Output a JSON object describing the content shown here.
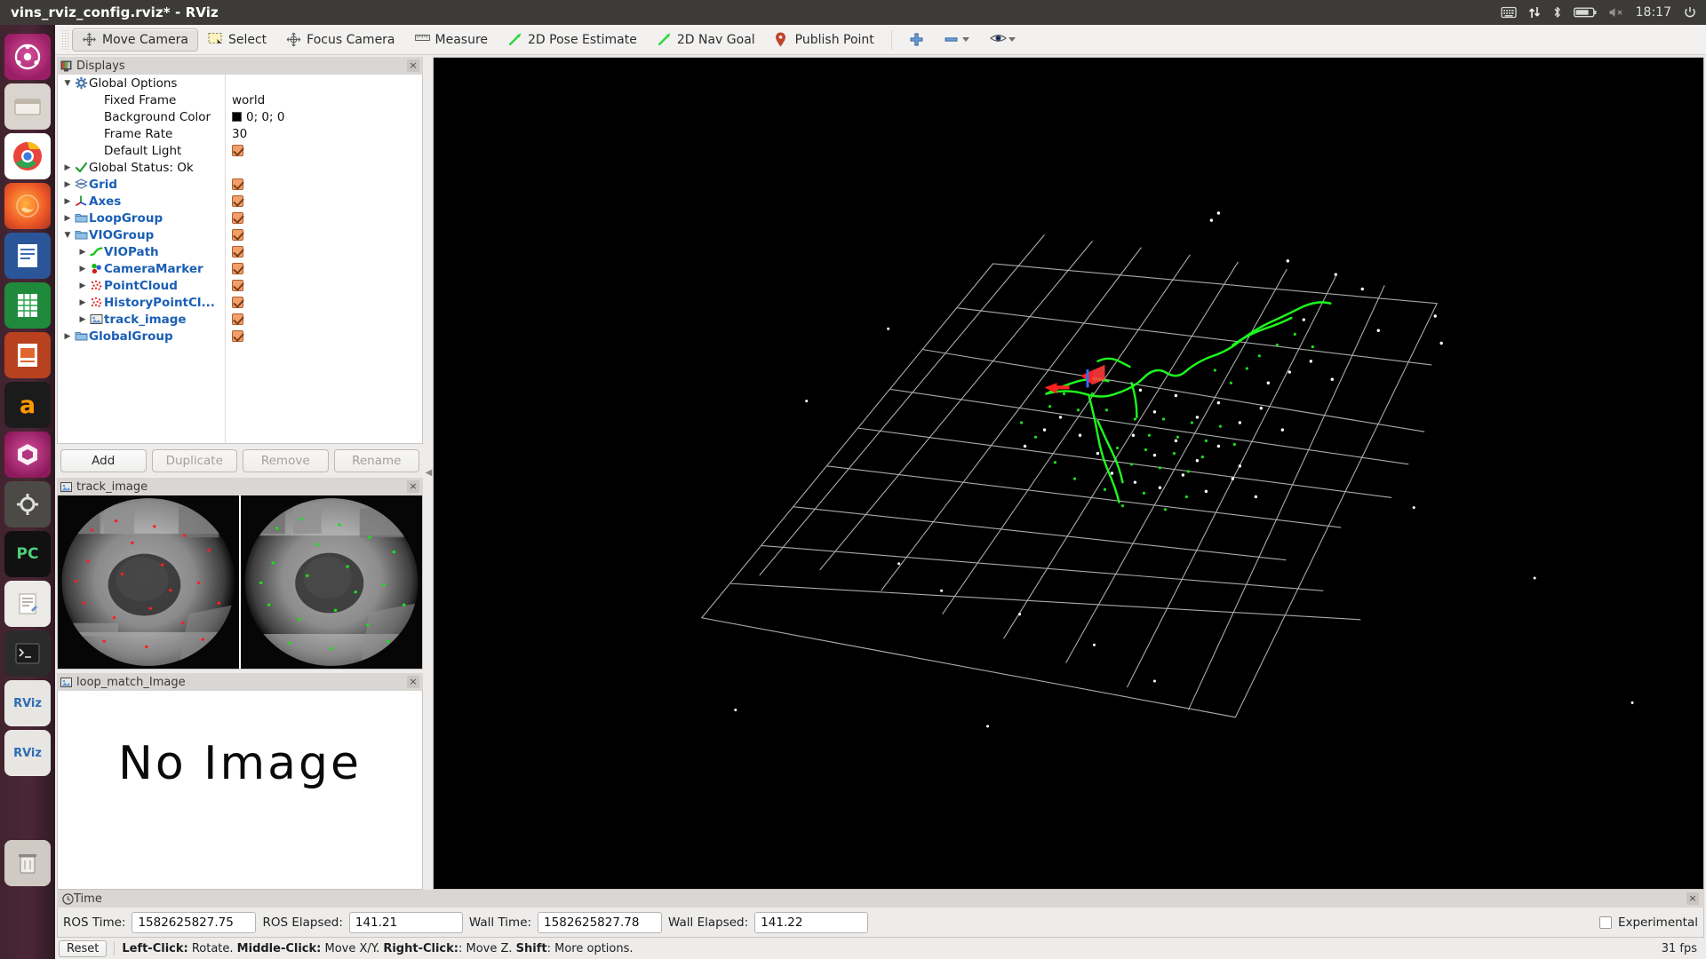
{
  "window": {
    "title": "vins_rviz_config.rviz* - RViz"
  },
  "tray": {
    "icons": [
      "keyboard-icon",
      "network-icon",
      "bluetooth-icon",
      "battery-icon",
      "volume-muted-icon"
    ],
    "clock": "18:17",
    "power_icon": "power-icon"
  },
  "launcher": {
    "items": [
      {
        "name": "ubuntu-dash",
        "glyph": "●"
      },
      {
        "name": "files",
        "glyph": "▤"
      },
      {
        "name": "chrome",
        "glyph": "●"
      },
      {
        "name": "firefox",
        "glyph": "●"
      },
      {
        "name": "libreoffice-writer",
        "glyph": "▤"
      },
      {
        "name": "libreoffice-calc",
        "glyph": "▤"
      },
      {
        "name": "libreoffice-impress",
        "glyph": "▤"
      },
      {
        "name": "amazon",
        "glyph": "a"
      },
      {
        "name": "ubuntu-software",
        "glyph": "●"
      },
      {
        "name": "pycharm",
        "glyph": "PC"
      },
      {
        "name": "system-settings",
        "glyph": "●"
      },
      {
        "name": "text-editor",
        "glyph": "✎"
      },
      {
        "name": "terminal",
        "glyph": "▣"
      },
      {
        "name": "rviz-1",
        "glyph": "RViz"
      },
      {
        "name": "rviz-2",
        "glyph": "RViz"
      },
      {
        "name": "trash",
        "glyph": "▤"
      }
    ]
  },
  "toolbar": {
    "buttons": [
      {
        "label": "Move Camera",
        "icon": "move-camera-icon",
        "active": true
      },
      {
        "label": "Select",
        "icon": "select-icon",
        "active": false
      },
      {
        "label": "Focus Camera",
        "icon": "focus-camera-icon",
        "active": false
      },
      {
        "label": "Measure",
        "icon": "measure-icon",
        "active": false
      },
      {
        "label": "2D Pose Estimate",
        "icon": "pose-arrow-icon",
        "active": false
      },
      {
        "label": "2D Nav Goal",
        "icon": "nav-arrow-icon",
        "active": false
      },
      {
        "label": "Publish Point",
        "icon": "map-pin-icon",
        "active": false
      }
    ],
    "add_tool_icon": "plus-icon",
    "remove_tool_icon": "minus-icon",
    "visibility_icon": "eye-icon",
    "dropdown_icon": "chevron-down-icon"
  },
  "displays_panel": {
    "title": "Displays",
    "icon": "displays-icon",
    "close_icon": "close-icon",
    "tree": [
      {
        "indent": 0,
        "arrow": "down",
        "icon": "gear-icon",
        "label": "Global Options",
        "blue": false,
        "value": "",
        "checkbox": false
      },
      {
        "indent": 1,
        "arrow": "none",
        "icon": "none",
        "label": "Fixed Frame",
        "blue": false,
        "value": "world",
        "checkbox": false
      },
      {
        "indent": 1,
        "arrow": "none",
        "icon": "none",
        "label": "Background Color",
        "blue": false,
        "value": "0; 0; 0",
        "swatch": "#000000",
        "checkbox": false
      },
      {
        "indent": 1,
        "arrow": "none",
        "icon": "none",
        "label": "Frame Rate",
        "blue": false,
        "value": "30",
        "checkbox": false
      },
      {
        "indent": 1,
        "arrow": "none",
        "icon": "none",
        "label": "Default Light",
        "blue": false,
        "value": "",
        "checkbox": true
      },
      {
        "indent": 0,
        "arrow": "right",
        "icon": "check-icon",
        "label": "Global Status: Ok",
        "blue": false,
        "value": "",
        "checkbox": false
      },
      {
        "indent": 0,
        "arrow": "right",
        "icon": "grid-icon",
        "label": "Grid",
        "blue": true,
        "value": "",
        "checkbox": true
      },
      {
        "indent": 0,
        "arrow": "right",
        "icon": "axes-icon",
        "label": "Axes",
        "blue": true,
        "value": "",
        "checkbox": true
      },
      {
        "indent": 0,
        "arrow": "right",
        "icon": "folder-icon",
        "label": "LoopGroup",
        "blue": true,
        "value": "",
        "checkbox": true
      },
      {
        "indent": 0,
        "arrow": "down",
        "icon": "folder-icon",
        "label": "VIOGroup",
        "blue": true,
        "value": "",
        "checkbox": true
      },
      {
        "indent": 1,
        "arrow": "right",
        "icon": "path-icon",
        "label": "VIOPath",
        "blue": true,
        "value": "",
        "checkbox": true
      },
      {
        "indent": 1,
        "arrow": "right",
        "icon": "marker-icon",
        "label": "CameraMarker",
        "blue": true,
        "value": "",
        "checkbox": true
      },
      {
        "indent": 1,
        "arrow": "right",
        "icon": "pointcloud-icon",
        "label": "PointCloud",
        "blue": true,
        "value": "",
        "checkbox": true
      },
      {
        "indent": 1,
        "arrow": "right",
        "icon": "pointcloud-icon",
        "label": "HistoryPointCl...",
        "blue": true,
        "value": "",
        "checkbox": true
      },
      {
        "indent": 1,
        "arrow": "right",
        "icon": "image-icon",
        "label": "track_image",
        "blue": true,
        "value": "",
        "checkbox": true
      },
      {
        "indent": 0,
        "arrow": "right",
        "icon": "folder-icon",
        "label": "GlobalGroup",
        "blue": true,
        "value": "",
        "checkbox": true
      }
    ],
    "buttons": [
      {
        "label": "Add",
        "enabled": true
      },
      {
        "label": "Duplicate",
        "enabled": false
      },
      {
        "label": "Remove",
        "enabled": false
      },
      {
        "label": "Rename",
        "enabled": false
      }
    ]
  },
  "track_image_panel": {
    "title": "track_image",
    "icon": "image-icon",
    "close_icon": "close-icon"
  },
  "loop_match_panel": {
    "title": "loop_match_Image",
    "icon": "image-icon",
    "close_icon": "close-icon",
    "no_image_text": "No Image"
  },
  "time_panel": {
    "title": "Time",
    "icon": "clock-icon",
    "close_icon": "close-icon",
    "fields": [
      {
        "label": "ROS Time:",
        "value": "1582625827.75",
        "width": "long"
      },
      {
        "label": "ROS Elapsed:",
        "value": "141.21",
        "width": "short"
      },
      {
        "label": "Wall Time:",
        "value": "1582625827.78",
        "width": "long"
      },
      {
        "label": "Wall Elapsed:",
        "value": "141.22",
        "width": "short"
      }
    ],
    "experimental_label": "Experimental",
    "experimental_checked": false
  },
  "status_bar": {
    "reset_label": "Reset",
    "hint_parts": [
      {
        "text": "Left-Click:",
        "bold": true
      },
      {
        "text": " Rotate. ",
        "bold": false
      },
      {
        "text": "Middle-Click:",
        "bold": true
      },
      {
        "text": " Move X/Y. ",
        "bold": false
      },
      {
        "text": "Right-Click:",
        "bold": true
      },
      {
        "text": ": Move Z. ",
        "bold": false
      },
      {
        "text": "Shift",
        "bold": true
      },
      {
        "text": ": More options.",
        "bold": false
      }
    ],
    "fps": "31 fps"
  },
  "render_view": {
    "background_color": "#000000",
    "grid_color": "#b4b4b4",
    "trajectory_color": "#00ff00",
    "marker_color": "#ff0000",
    "point_color": "#ffffff"
  }
}
